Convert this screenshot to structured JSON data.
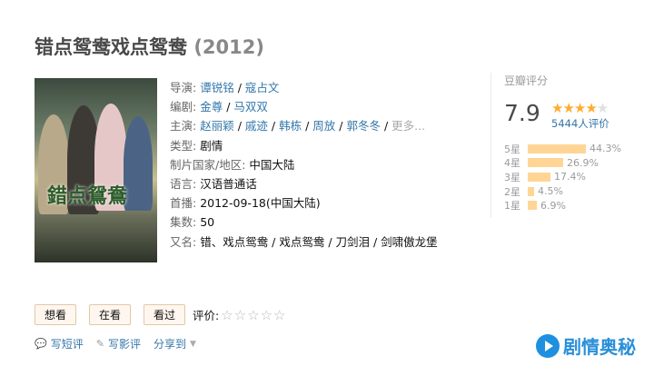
{
  "title": "错点鸳鸯戏点鸳鸯",
  "year": "(2012)",
  "info": {
    "director_label": "导演:",
    "directors": [
      "谭锐铭",
      "寇占文"
    ],
    "writer_label": "编剧:",
    "writers": [
      "金尊",
      "马双双"
    ],
    "cast_label": "主演:",
    "cast": [
      "赵丽颖",
      "戚迹",
      "韩栋",
      "周放",
      "郭冬冬"
    ],
    "more": "更多...",
    "genre_label": "类型:",
    "genre": "剧情",
    "country_label": "制片国家/地区:",
    "country": "中国大陆",
    "language_label": "语言:",
    "language": "汉语普通话",
    "premiere_label": "首播:",
    "premiere": "2012-09-18(中国大陆)",
    "episodes_label": "集数:",
    "episodes": "50",
    "aka_label": "又名:",
    "aka": "错、戏点鸳鸯 / 戏点鸳鸯 / 刀剑泪 / 剑啸傲龙堡"
  },
  "rating": {
    "header": "豆瓣评分",
    "score": "7.9",
    "stars_filled": 4,
    "stars_total": 5,
    "count": "5444人评价",
    "distribution": [
      {
        "label": "5星",
        "percent": 44.3,
        "text": "44.3%"
      },
      {
        "label": "4星",
        "percent": 26.9,
        "text": "26.9%"
      },
      {
        "label": "3星",
        "percent": 17.4,
        "text": "17.4%"
      },
      {
        "label": "2星",
        "percent": 4.5,
        "text": "4.5%"
      },
      {
        "label": "1星",
        "percent": 6.9,
        "text": "6.9%"
      }
    ]
  },
  "actions": {
    "want": "想看",
    "watching": "在看",
    "watched": "看过",
    "evaluate": "评价:",
    "eval_stars": "☆☆☆☆☆"
  },
  "links": {
    "short_review": "写短评",
    "review": "写影评",
    "share": "分享到"
  },
  "brand": "剧情奥秘",
  "colors": {
    "link": "#3377aa",
    "star": "#ffac2d",
    "bar": "#ffd596"
  }
}
